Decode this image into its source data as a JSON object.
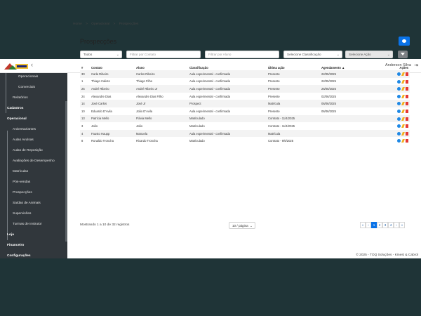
{
  "header": {
    "user_name": "Anderson Silva",
    "collapse_icon": "chevron-left-icon",
    "logout_icon": "logout-icon"
  },
  "sidebar": {
    "items": [
      {
        "label": "Operacionais"
      },
      {
        "label": "Comerciais"
      },
      {
        "label": "Relatórios"
      },
      {
        "label": "Cadastros"
      },
      {
        "label": "Operacional"
      },
      {
        "label": "Aniversariantes"
      },
      {
        "label": "Aulas Avulsas"
      },
      {
        "label": "Aulas de Reposição"
      },
      {
        "label": "Avaliações de Desempenho"
      },
      {
        "label": "Matrículas"
      },
      {
        "label": "Pós-vendas"
      },
      {
        "label": "Prospecções"
      },
      {
        "label": "Saídas de Animais"
      },
      {
        "label": "Supervisões"
      },
      {
        "label": "Turmas de Instrutor"
      },
      {
        "label": "Loja"
      },
      {
        "label": "Financeiro"
      },
      {
        "label": "Configurações"
      }
    ]
  },
  "breadcrumb": {
    "home": "Home",
    "sep": ">",
    "section": "Operacional",
    "current": "Prospecções"
  },
  "page": {
    "title": "Prospecções"
  },
  "filters": {
    "status": "Todos",
    "contato_placeholder": "Filtrar por Contato",
    "aluno_placeholder": "Filtrar por Aluno",
    "classificacao": "Selecione Classificação",
    "acao": "Selecione Ação"
  },
  "table": {
    "headers": [
      "#",
      "Contato",
      "Aluno",
      "Classificação",
      "Última ação",
      "Agendamento ▲",
      "Ações"
    ],
    "rows": [
      [
        "30",
        "Carla Ribeiro",
        "Carlos Ribeiro",
        "Aula experimental - confirmada",
        "Presente",
        "22/05/2025"
      ],
      [
        "1",
        "Thiago Calixto",
        "Thiago Filho",
        "Aula experimental - confirmada",
        "Presente",
        "22/05/2025"
      ],
      [
        "25",
        "André Ribeiro",
        "André Ribeiro Jr",
        "Aula experimental - confirmada",
        "Presente",
        "26/05/2025"
      ],
      [
        "24",
        "Alexandre Dias",
        "Alexandre Dias Filho",
        "Aula experimental - confirmada",
        "Presente",
        "02/06/2025"
      ],
      [
        "14",
        "José Carlos",
        "José Jr",
        "Prospect",
        "Matrícula",
        "06/06/2025"
      ],
      [
        "10",
        "Eduardo D'Avila",
        "João D'Avila",
        "Aula experimental - confirmada",
        "Presente",
        "06/06/2025"
      ],
      [
        "13",
        "Patrícia Mello",
        "Flávia Mello",
        "Matriculado",
        "Contrato - 11/4/2025",
        ""
      ],
      [
        "3",
        "João",
        "João",
        "Matriculado",
        "Contrato - 11/4/2025",
        ""
      ],
      [
        "4",
        "Fausto Haupp",
        "Manuela",
        "Aula experimental - confirmada",
        "Matrícula",
        ""
      ],
      [
        "8",
        "Ronaldo Troncha",
        "Ricardo Troncha",
        "Matriculado",
        "Contrato - 9/6/2025",
        ""
      ]
    ]
  },
  "pagination": {
    "results_text": "Mostrando 1 a 10 de 32 registros",
    "per_page": "10 / página",
    "pages": [
      "«",
      "‹",
      "1",
      "2",
      "3",
      "4",
      "›",
      "»"
    ],
    "active_page": "1"
  },
  "footer": {
    "text": "© 2025 - TOQ Soluções - Kinest & Cabrol"
  },
  "colors": {
    "accent": "#0a73e8",
    "sidebar": "#31373c",
    "backdrop": "#1f3437"
  }
}
